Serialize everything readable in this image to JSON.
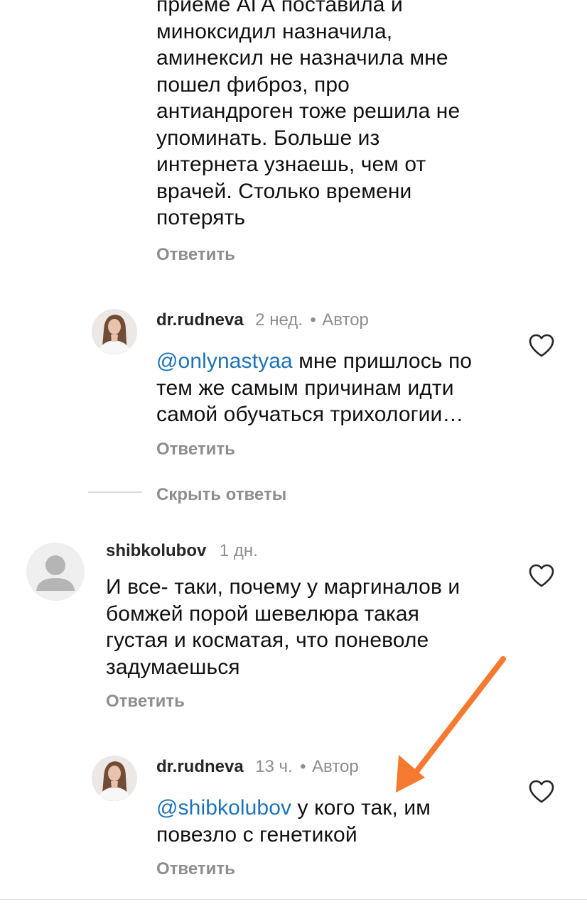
{
  "comment0": {
    "lines": [
      "приеме АГА поставила и",
      "миноксидил назначила,",
      "аминексил не назначила мне",
      "пошел фиброз, про",
      "антиандроген тоже решила не",
      "упоминать. Больше из",
      "интернета узнаешь, чем от",
      "врачей. Столько времени",
      "потерять"
    ],
    "reply_label": "Ответить"
  },
  "reply1": {
    "username": "dr.rudneva",
    "time": "2 нед.",
    "separator": "•",
    "author_badge": "Автор",
    "mention": "@onlynastyaa",
    "line1_rest": " мне пришлось по",
    "line2": "тем же самым причинам идти",
    "line3": "самой обучаться трихологии…",
    "reply_label": "Ответить",
    "like_icon": "heart-outline-icon"
  },
  "hide_replies_label": "Скрыть ответы",
  "comment2": {
    "username": "shibkolubov",
    "time": "1 дн.",
    "lines": [
      "И все- таки, почему у маргиналов и",
      "бомжей порой шевелюра такая",
      "густая и косматая, что поневоле",
      "задумаешься"
    ],
    "reply_label": "Ответить",
    "avatar_icon": "default-user-avatar-icon",
    "like_icon": "heart-outline-icon"
  },
  "reply3": {
    "username": "dr.rudneva",
    "time": "13 ч.",
    "separator": "•",
    "author_badge": "Автор",
    "mention": "@shibkolubov",
    "line1_rest": " у кого так, им",
    "line2": "повезло с генетикой",
    "reply_label": "Ответить",
    "like_icon": "heart-outline-icon"
  },
  "annotation_arrow": {
    "color": "#f57a30",
    "icon": "arrow-annotation-icon"
  },
  "colors": {
    "mention": "#1d73b9",
    "secondary_text": "#8e8e8e",
    "primary_text": "#111111"
  }
}
